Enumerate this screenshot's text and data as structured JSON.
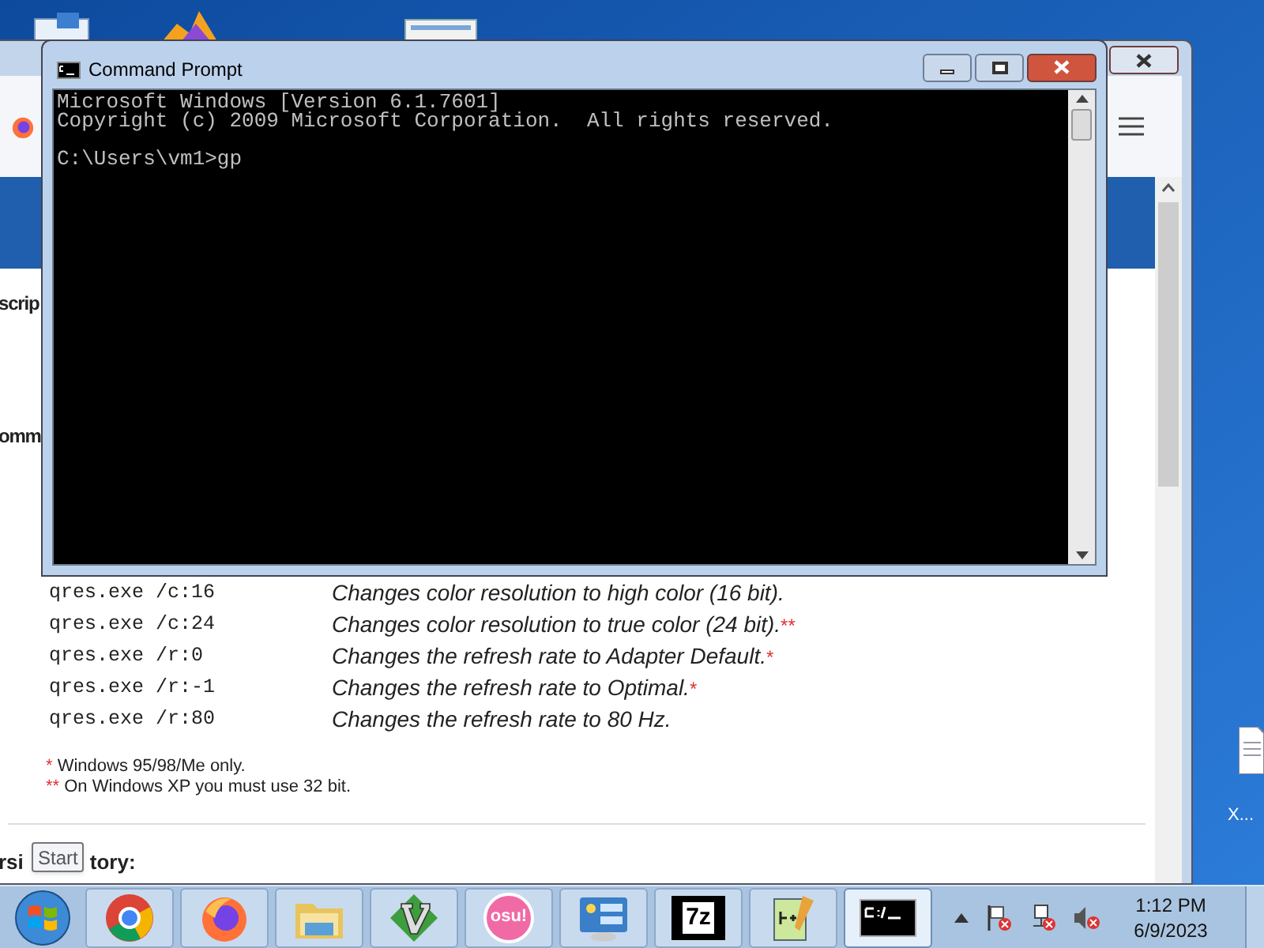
{
  "desktop": {
    "icon_label": "X..."
  },
  "browser": {
    "headings": [
      "scrip",
      "omm"
    ],
    "rows": [
      {
        "command": "qres.exe /c:16",
        "description": "Changes color resolution to high color (16 bit)."
      },
      {
        "command": "qres.exe /c:24",
        "description": "Changes color resolution to true color (24 bit).",
        "note": "**"
      },
      {
        "command": "qres.exe /r:0",
        "description": "Changes the refresh rate to Adapter Default.",
        "note": "*"
      },
      {
        "command": "qres.exe /r:-1",
        "description": "Changes the refresh rate to Optimal.",
        "note": "*"
      },
      {
        "command": "qres.exe /r:80",
        "description": "Changes the refresh rate to 80 Hz."
      }
    ],
    "footnotes": [
      {
        "mark": "*",
        "text": "Windows 95/98/Me only."
      },
      {
        "mark": "**",
        "text": "On Windows XP you must use 32 bit."
      }
    ],
    "section_heading_parts": [
      "rsi",
      "tory:"
    ]
  },
  "tooltip": "Start",
  "cmd": {
    "title": "Command Prompt",
    "banner": [
      "Microsoft Windows [Version 6.1.7601]",
      "Copyright (c) 2009 Microsoft Corporation.  All rights reserved."
    ],
    "prompt": "C:\\Users\\vm1>gp"
  },
  "taskbar": {
    "items": [
      {
        "kind": "chrome",
        "selected": false
      },
      {
        "kind": "firefox",
        "selected": false
      },
      {
        "kind": "explorer",
        "selected": false
      },
      {
        "kind": "vim",
        "selected": false
      },
      {
        "kind": "osu",
        "label": "osu!",
        "selected": false
      },
      {
        "kind": "panel",
        "selected": false
      },
      {
        "kind": "zip",
        "label": "7z",
        "selected": false
      },
      {
        "kind": "notepad",
        "selected": false
      },
      {
        "kind": "console",
        "selected": true
      }
    ],
    "clock": {
      "time": "1:12 PM",
      "date": "6/9/2023"
    }
  }
}
